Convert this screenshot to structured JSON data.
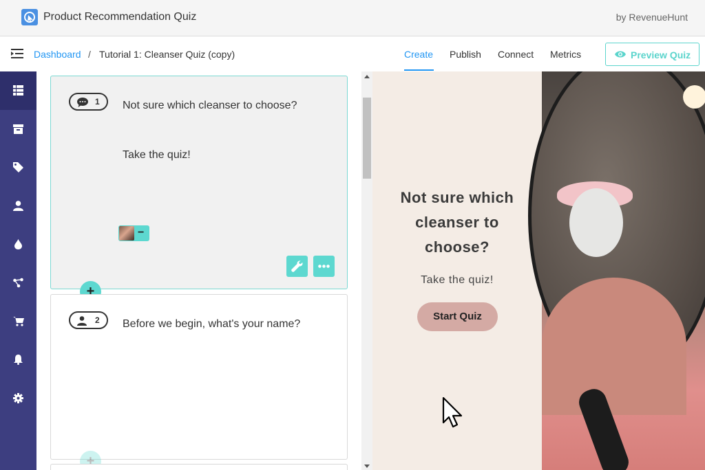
{
  "app": {
    "title": "Product Recommendation Quiz",
    "by": "by RevenueHunt"
  },
  "breadcrumb": {
    "home": "Dashboard",
    "separator": "/",
    "current": "Tutorial 1: Cleanser Quiz (copy)"
  },
  "tabs": [
    {
      "label": "Create",
      "active": true
    },
    {
      "label": "Publish",
      "active": false
    },
    {
      "label": "Connect",
      "active": false
    },
    {
      "label": "Metrics",
      "active": false
    }
  ],
  "preview_button": {
    "label": "Preview Quiz"
  },
  "sidebar": {
    "items": [
      {
        "icon": "list-icon",
        "active": true
      },
      {
        "icon": "box-icon"
      },
      {
        "icon": "tag-icon"
      },
      {
        "icon": "user-icon"
      },
      {
        "icon": "drop-icon"
      },
      {
        "icon": "share-nodes-icon"
      },
      {
        "icon": "cart-icon"
      },
      {
        "icon": "bell-icon"
      },
      {
        "icon": "gear-icon"
      }
    ]
  },
  "editor": {
    "cards": [
      {
        "number": "1",
        "icon": "comment-icon",
        "title": "Not sure which cleanser to choose?",
        "subtitle": "Take the quiz!"
      },
      {
        "number": "2",
        "icon": "person-icon",
        "title": "Before we begin, what's your name?"
      }
    ],
    "thumb_remove": "−",
    "add_symbol": "+"
  },
  "preview": {
    "title": "Not sure which cleanser to choose?",
    "subtitle": "Take the quiz!",
    "button": "Start Quiz"
  },
  "colors": {
    "accent": "#5dd8d0",
    "link": "#2196f3",
    "sidebar": "#3d3e80",
    "preview_bg": "#f4ece5",
    "cta": "#d4aaa4"
  }
}
